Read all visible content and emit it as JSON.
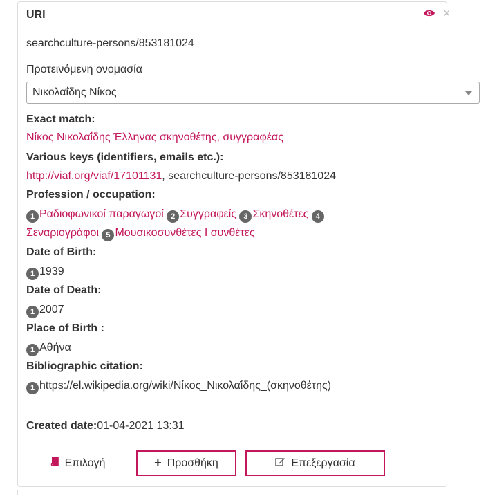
{
  "header": {
    "label": "URI",
    "value": "searchculture-persons/853181024"
  },
  "name_select": {
    "label": "Προτεινόμενη ονομασία",
    "selected": "Νικολαΐδης Νίκος"
  },
  "exact_match": {
    "label": "Exact match:",
    "value": "Νίκος Νικολαΐδης Έλληνας σκηνοθέτης, συγγραφέας"
  },
  "various_keys": {
    "label": "Various keys (identifiers, emails etc.):",
    "link": "http://viaf.org/viaf/17101131",
    "rest": ", searchculture-persons/853181024"
  },
  "profession": {
    "label": "Profession / occupation:",
    "items": [
      {
        "n": "1",
        "text": "Ραδιοφωνικοί παραγωγοί"
      },
      {
        "n": "2",
        "text": "Συγγραφείς"
      },
      {
        "n": "3",
        "text": "Σκηνοθέτες"
      },
      {
        "n": "4",
        "text": "Σεναριογράφοι"
      },
      {
        "n": "5",
        "text": "Μουσικοσυνθέτες Ι συνθέτες"
      }
    ]
  },
  "date_of_birth": {
    "label": "Date of Birth:",
    "n": "1",
    "value": "1939"
  },
  "date_of_death": {
    "label": "Date of Death:",
    "n": "1",
    "value": "2007"
  },
  "place_of_birth": {
    "label": "Place of Birth :",
    "n": "1",
    "value": "Αθήνα"
  },
  "citation": {
    "label": "Bibliographic citation:",
    "n": "1",
    "value": "https://el.wikipedia.org/wiki/Νίκος_Νικολαΐδης_(σκηνοθέτης)"
  },
  "created": {
    "label": "Created date:",
    "value": "01-04-2021 13:31"
  },
  "buttons": {
    "select": "Επιλογή",
    "add": "Προσθήκη",
    "edit": "Επεξεργασία"
  },
  "icons": {
    "eye": "eye-icon",
    "close": "close-icon",
    "book": "book-icon",
    "plus": "plus-icon",
    "edit": "edit-icon"
  },
  "colors": {
    "accent": "#c2185b",
    "badge": "#666666",
    "border": "#dddddd"
  }
}
